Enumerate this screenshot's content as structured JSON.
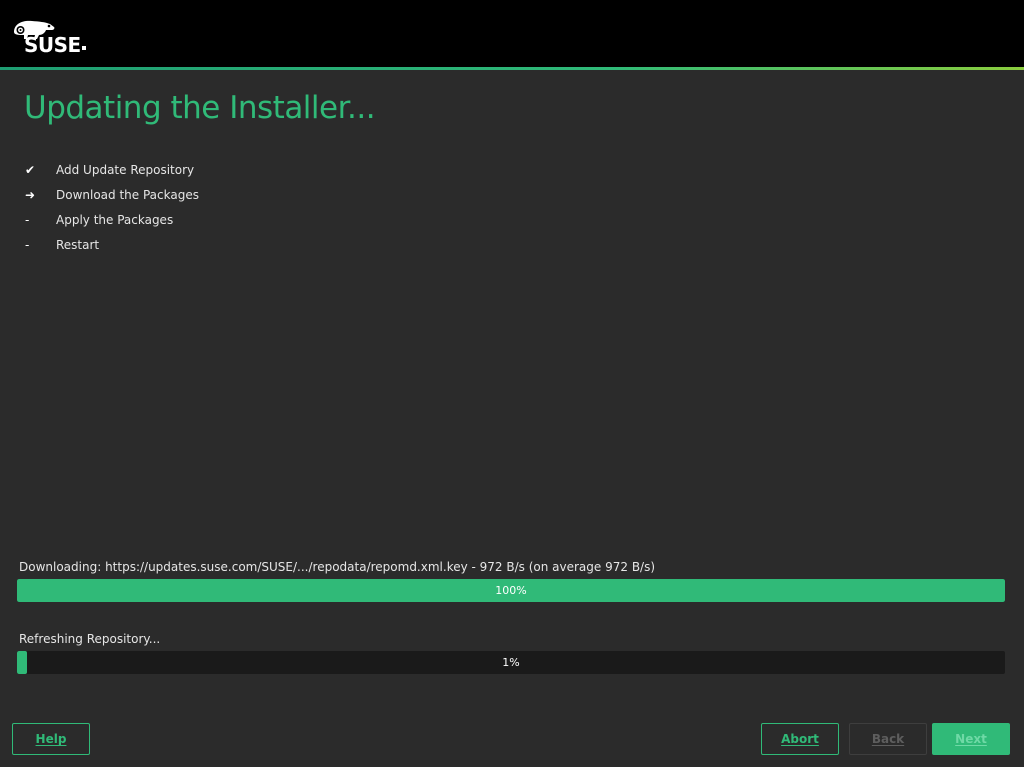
{
  "header": {
    "logo_text": "SUSE",
    "accent_color": "#30ba78"
  },
  "page": {
    "title": "Updating the Installer..."
  },
  "steps": [
    {
      "marker": "✔",
      "label": "Add Update Repository",
      "state": "done"
    },
    {
      "marker": "➜",
      "label": "Download the Packages",
      "state": "current"
    },
    {
      "marker": "-",
      "label": "Apply the Packages",
      "state": "pending"
    },
    {
      "marker": "-",
      "label": "Restart",
      "state": "pending"
    }
  ],
  "progress": {
    "download": {
      "label": "Downloading: https://updates.suse.com/SUSE/.../repodata/repomd.xml.key - 972 B/s (on average 972 B/s)",
      "percent_text": "100%",
      "value": 100
    },
    "refresh": {
      "label": "Refreshing Repository...",
      "percent_text": "1%",
      "value": 1
    }
  },
  "buttons": {
    "help": "Help",
    "abort": "Abort",
    "back": "Back",
    "next": "Next"
  }
}
